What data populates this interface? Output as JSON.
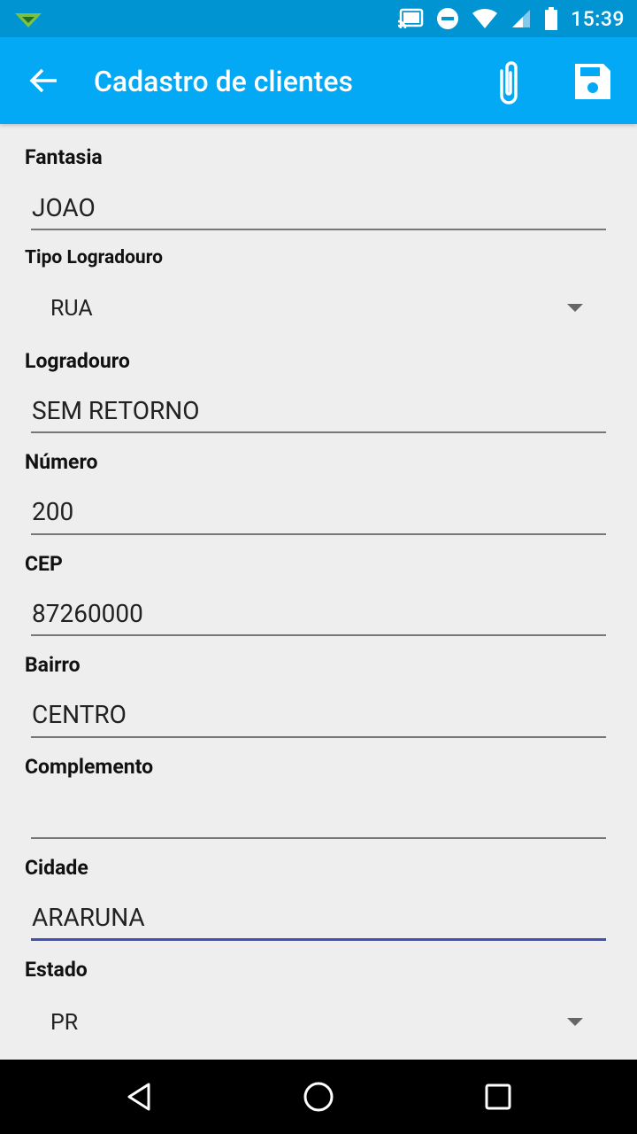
{
  "status_bar": {
    "time": "15:39",
    "icons": [
      "notification-app-icon",
      "cast-icon",
      "do-not-disturb-icon",
      "wifi-icon",
      "cellular-signal-icon",
      "battery-icon"
    ]
  },
  "app_bar": {
    "title": "Cadastro de clientes",
    "icons": [
      "back-arrow-icon",
      "attachment-icon",
      "save-icon"
    ]
  },
  "form": {
    "fantasia": {
      "label": "Fantasia",
      "value": "JOAO"
    },
    "tipo_logradouro": {
      "label": "Tipo Logradouro",
      "value": "RUA"
    },
    "logradouro": {
      "label": "Logradouro",
      "value": "SEM RETORNO"
    },
    "numero": {
      "label": "Número",
      "value": "200"
    },
    "cep": {
      "label": "CEP",
      "value": "87260000"
    },
    "bairro": {
      "label": "Bairro",
      "value": "CENTRO"
    },
    "complemento": {
      "label": "Complemento",
      "value": ""
    },
    "cidade": {
      "label": "Cidade",
      "value": "ARARUNA"
    },
    "estado": {
      "label": "Estado",
      "value": "PR"
    }
  },
  "colors": {
    "status_bar": "#0094d3",
    "app_bar": "#03a9f4",
    "background": "#eeeeee",
    "focus_underline": "#3f51b5"
  },
  "nav_bar": {
    "icons": [
      "back-triangle-icon",
      "home-circle-icon",
      "recents-square-icon"
    ]
  }
}
